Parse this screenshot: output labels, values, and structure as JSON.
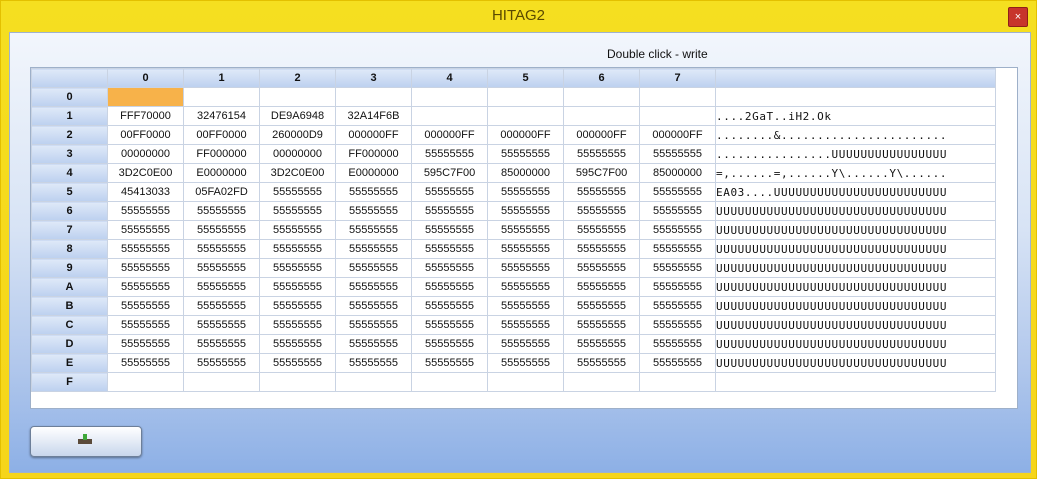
{
  "window": {
    "title": "HITAG2",
    "close_glyph": "×"
  },
  "hint": "Double click - write",
  "columns": [
    "0",
    "1",
    "2",
    "3",
    "4",
    "5",
    "6",
    "7"
  ],
  "rows": [
    {
      "label": "0",
      "cells": [
        "",
        "",
        "",
        "",
        "",
        "",
        "",
        ""
      ],
      "ascii": ""
    },
    {
      "label": "1",
      "cells": [
        "FFF70000",
        "32476154",
        "DE9A6948",
        "32A14F6B",
        "",
        "",
        "",
        ""
      ],
      "ascii": "....2GaT..iH2.Ok"
    },
    {
      "label": "2",
      "cells": [
        "00FF0000",
        "00FF0000",
        "260000D9",
        "000000FF",
        "000000FF",
        "000000FF",
        "000000FF",
        "000000FF"
      ],
      "ascii": "........&......................."
    },
    {
      "label": "3",
      "cells": [
        "00000000",
        "FF000000",
        "00000000",
        "FF000000",
        "55555555",
        "55555555",
        "55555555",
        "55555555"
      ],
      "ascii": "................UUUUUUUUUUUUUUUU"
    },
    {
      "label": "4",
      "cells": [
        "3D2C0E00",
        "E0000000",
        "3D2C0E00",
        "E0000000",
        "595C7F00",
        "85000000",
        "595C7F00",
        "85000000"
      ],
      "ascii": "=,......=,......Y\\......Y\\......"
    },
    {
      "label": "5",
      "cells": [
        "45413033",
        "05FA02FD",
        "55555555",
        "55555555",
        "55555555",
        "55555555",
        "55555555",
        "55555555"
      ],
      "ascii": "EA03....UUUUUUUUUUUUUUUUUUUUUUUU"
    },
    {
      "label": "6",
      "cells": [
        "55555555",
        "55555555",
        "55555555",
        "55555555",
        "55555555",
        "55555555",
        "55555555",
        "55555555"
      ],
      "ascii": "UUUUUUUUUUUUUUUUUUUUUUUUUUUUUUUU"
    },
    {
      "label": "7",
      "cells": [
        "55555555",
        "55555555",
        "55555555",
        "55555555",
        "55555555",
        "55555555",
        "55555555",
        "55555555"
      ],
      "ascii": "UUUUUUUUUUUUUUUUUUUUUUUUUUUUUUUU"
    },
    {
      "label": "8",
      "cells": [
        "55555555",
        "55555555",
        "55555555",
        "55555555",
        "55555555",
        "55555555",
        "55555555",
        "55555555"
      ],
      "ascii": "UUUUUUUUUUUUUUUUUUUUUUUUUUUUUUUU"
    },
    {
      "label": "9",
      "cells": [
        "55555555",
        "55555555",
        "55555555",
        "55555555",
        "55555555",
        "55555555",
        "55555555",
        "55555555"
      ],
      "ascii": "UUUUUUUUUUUUUUUUUUUUUUUUUUUUUUUU"
    },
    {
      "label": "A",
      "cells": [
        "55555555",
        "55555555",
        "55555555",
        "55555555",
        "55555555",
        "55555555",
        "55555555",
        "55555555"
      ],
      "ascii": "UUUUUUUUUUUUUUUUUUUUUUUUUUUUUUUU"
    },
    {
      "label": "B",
      "cells": [
        "55555555",
        "55555555",
        "55555555",
        "55555555",
        "55555555",
        "55555555",
        "55555555",
        "55555555"
      ],
      "ascii": "UUUUUUUUUUUUUUUUUUUUUUUUUUUUUUUU"
    },
    {
      "label": "C",
      "cells": [
        "55555555",
        "55555555",
        "55555555",
        "55555555",
        "55555555",
        "55555555",
        "55555555",
        "55555555"
      ],
      "ascii": "UUUUUUUUUUUUUUUUUUUUUUUUUUUUUUUU"
    },
    {
      "label": "D",
      "cells": [
        "55555555",
        "55555555",
        "55555555",
        "55555555",
        "55555555",
        "55555555",
        "55555555",
        "55555555"
      ],
      "ascii": "UUUUUUUUUUUUUUUUUUUUUUUUUUUUUUUU"
    },
    {
      "label": "E",
      "cells": [
        "55555555",
        "55555555",
        "55555555",
        "55555555",
        "55555555",
        "55555555",
        "55555555",
        "55555555"
      ],
      "ascii": "UUUUUUUUUUUUUUUUUUUUUUUUUUUUUUUU"
    },
    {
      "label": "F",
      "cells": [
        "",
        "",
        "",
        "",
        "",
        "",
        "",
        ""
      ],
      "ascii": ""
    }
  ],
  "selected_cell": {
    "row": 0,
    "col": 0
  },
  "action_button": {
    "icon": "card-reader-icon"
  },
  "colors": {
    "title_bar": "#f5df20",
    "selection": "#f7b24a",
    "header": "#bcd0ef"
  }
}
